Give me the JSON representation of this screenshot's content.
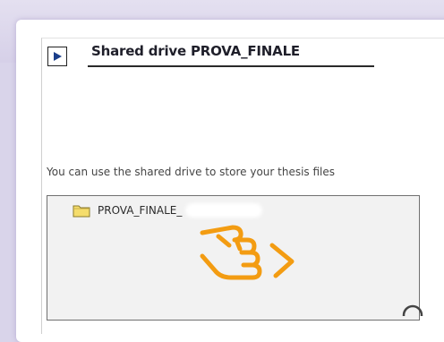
{
  "header": {
    "title": "Shared drive PROVA_FINALE"
  },
  "description": "You can use the shared drive to store your thesis files",
  "folder_list": {
    "items": [
      {
        "name": "PROVA_FINALE_"
      }
    ]
  },
  "icons": {
    "play": "play-icon",
    "folder": "folder-icon",
    "pointer": "hand-pointer-icon",
    "search": "search-icon"
  },
  "colors": {
    "accent": "#f39c12",
    "play": "#1a3e8a",
    "folder": "#f5dd6c"
  }
}
